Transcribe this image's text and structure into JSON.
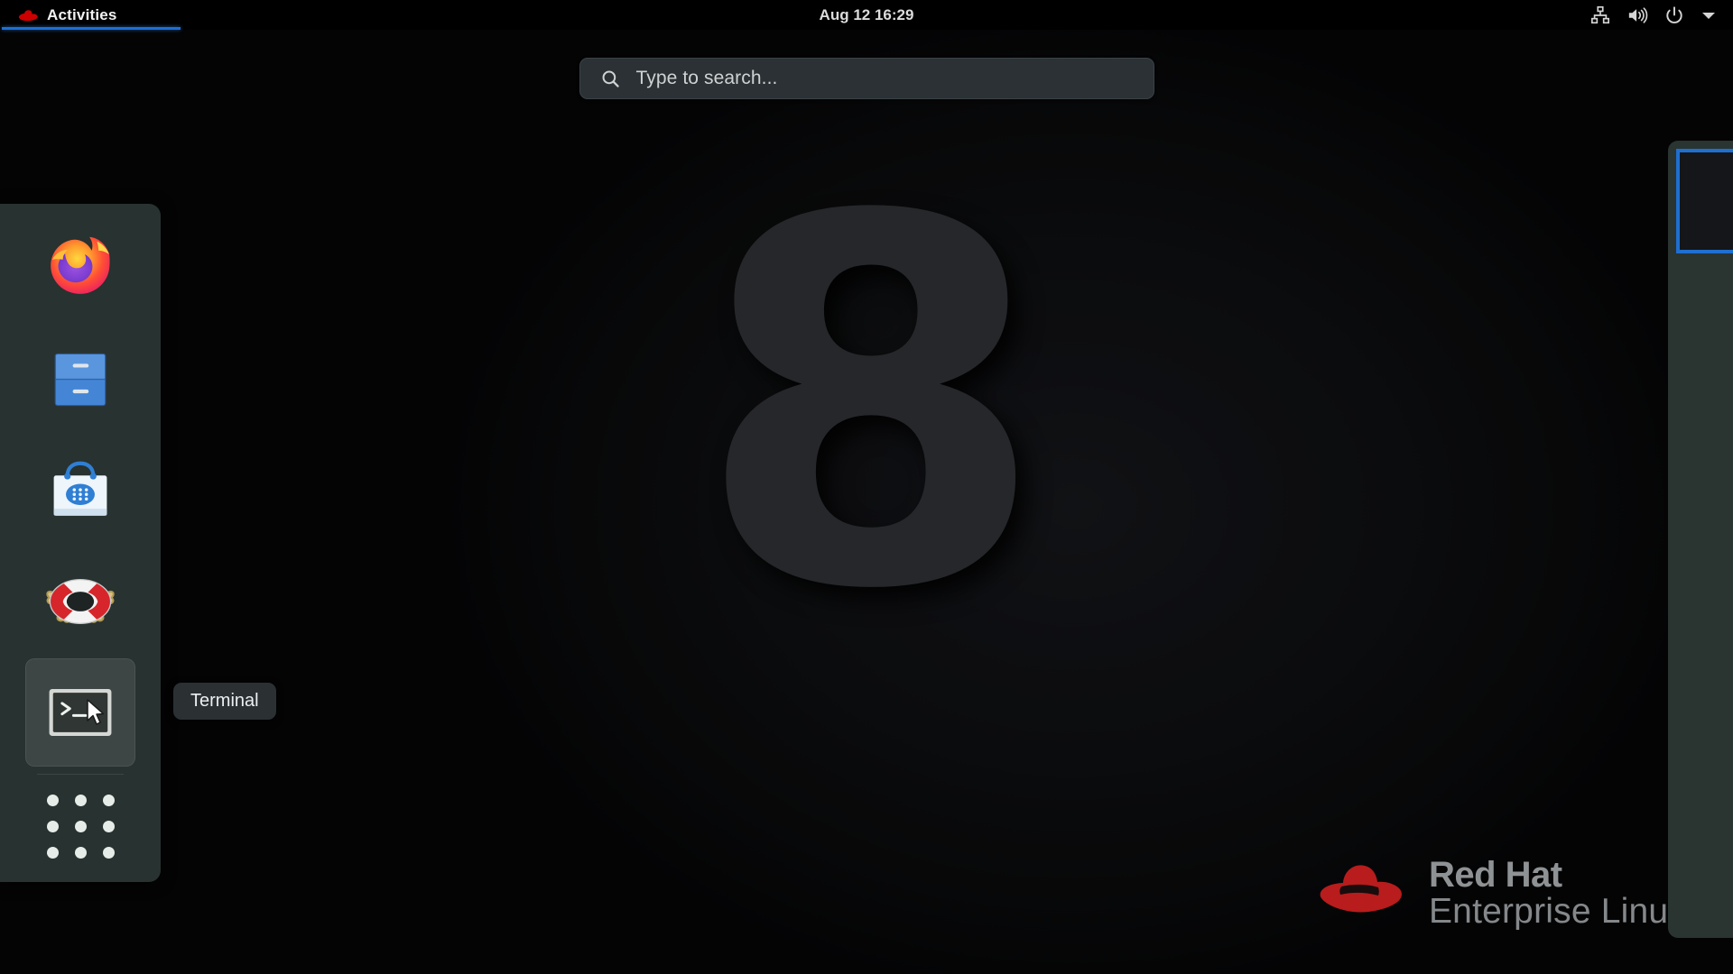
{
  "topbar": {
    "activities_label": "Activities",
    "activities_icon": "redhat-logo-icon",
    "clock": "Aug 12  16:29",
    "tray": [
      {
        "name": "network-wired-icon",
        "label": "Network"
      },
      {
        "name": "volume-speaker-icon",
        "label": "Volume"
      },
      {
        "name": "power-icon",
        "label": "Power"
      },
      {
        "name": "chevron-down-icon",
        "label": "System menu"
      }
    ]
  },
  "search": {
    "placeholder": "Type to search...",
    "value": "",
    "icon": "search-icon"
  },
  "dock": {
    "items": [
      {
        "name": "firefox",
        "label": "Firefox",
        "icon": "firefox-icon",
        "hovered": false
      },
      {
        "name": "files",
        "label": "Files",
        "icon": "file-cabinet-icon",
        "hovered": false
      },
      {
        "name": "software",
        "label": "Software",
        "icon": "shopping-bag-icon",
        "hovered": false
      },
      {
        "name": "help",
        "label": "Help",
        "icon": "lifebuoy-icon",
        "hovered": false
      },
      {
        "name": "terminal",
        "label": "Terminal",
        "icon": "terminal-icon",
        "hovered": true
      }
    ],
    "show_applications_label": "Show Applications",
    "show_applications_icon": "grid-dots-icon"
  },
  "tooltip": {
    "text": "Terminal"
  },
  "wallpaper": {
    "figure": "8"
  },
  "workspaces": {
    "count": 1,
    "selected_index": 0
  },
  "branding": {
    "line1": "Red Hat",
    "line2": "Enterprise Linux",
    "logo": "redhat-fedora-icon"
  },
  "colors": {
    "accent_blue": "#1c6fd6",
    "dock_bg": "#283230",
    "topbar_bg": "#000000",
    "search_bg": "#2b3134",
    "redhat_red": "#cc0000"
  }
}
